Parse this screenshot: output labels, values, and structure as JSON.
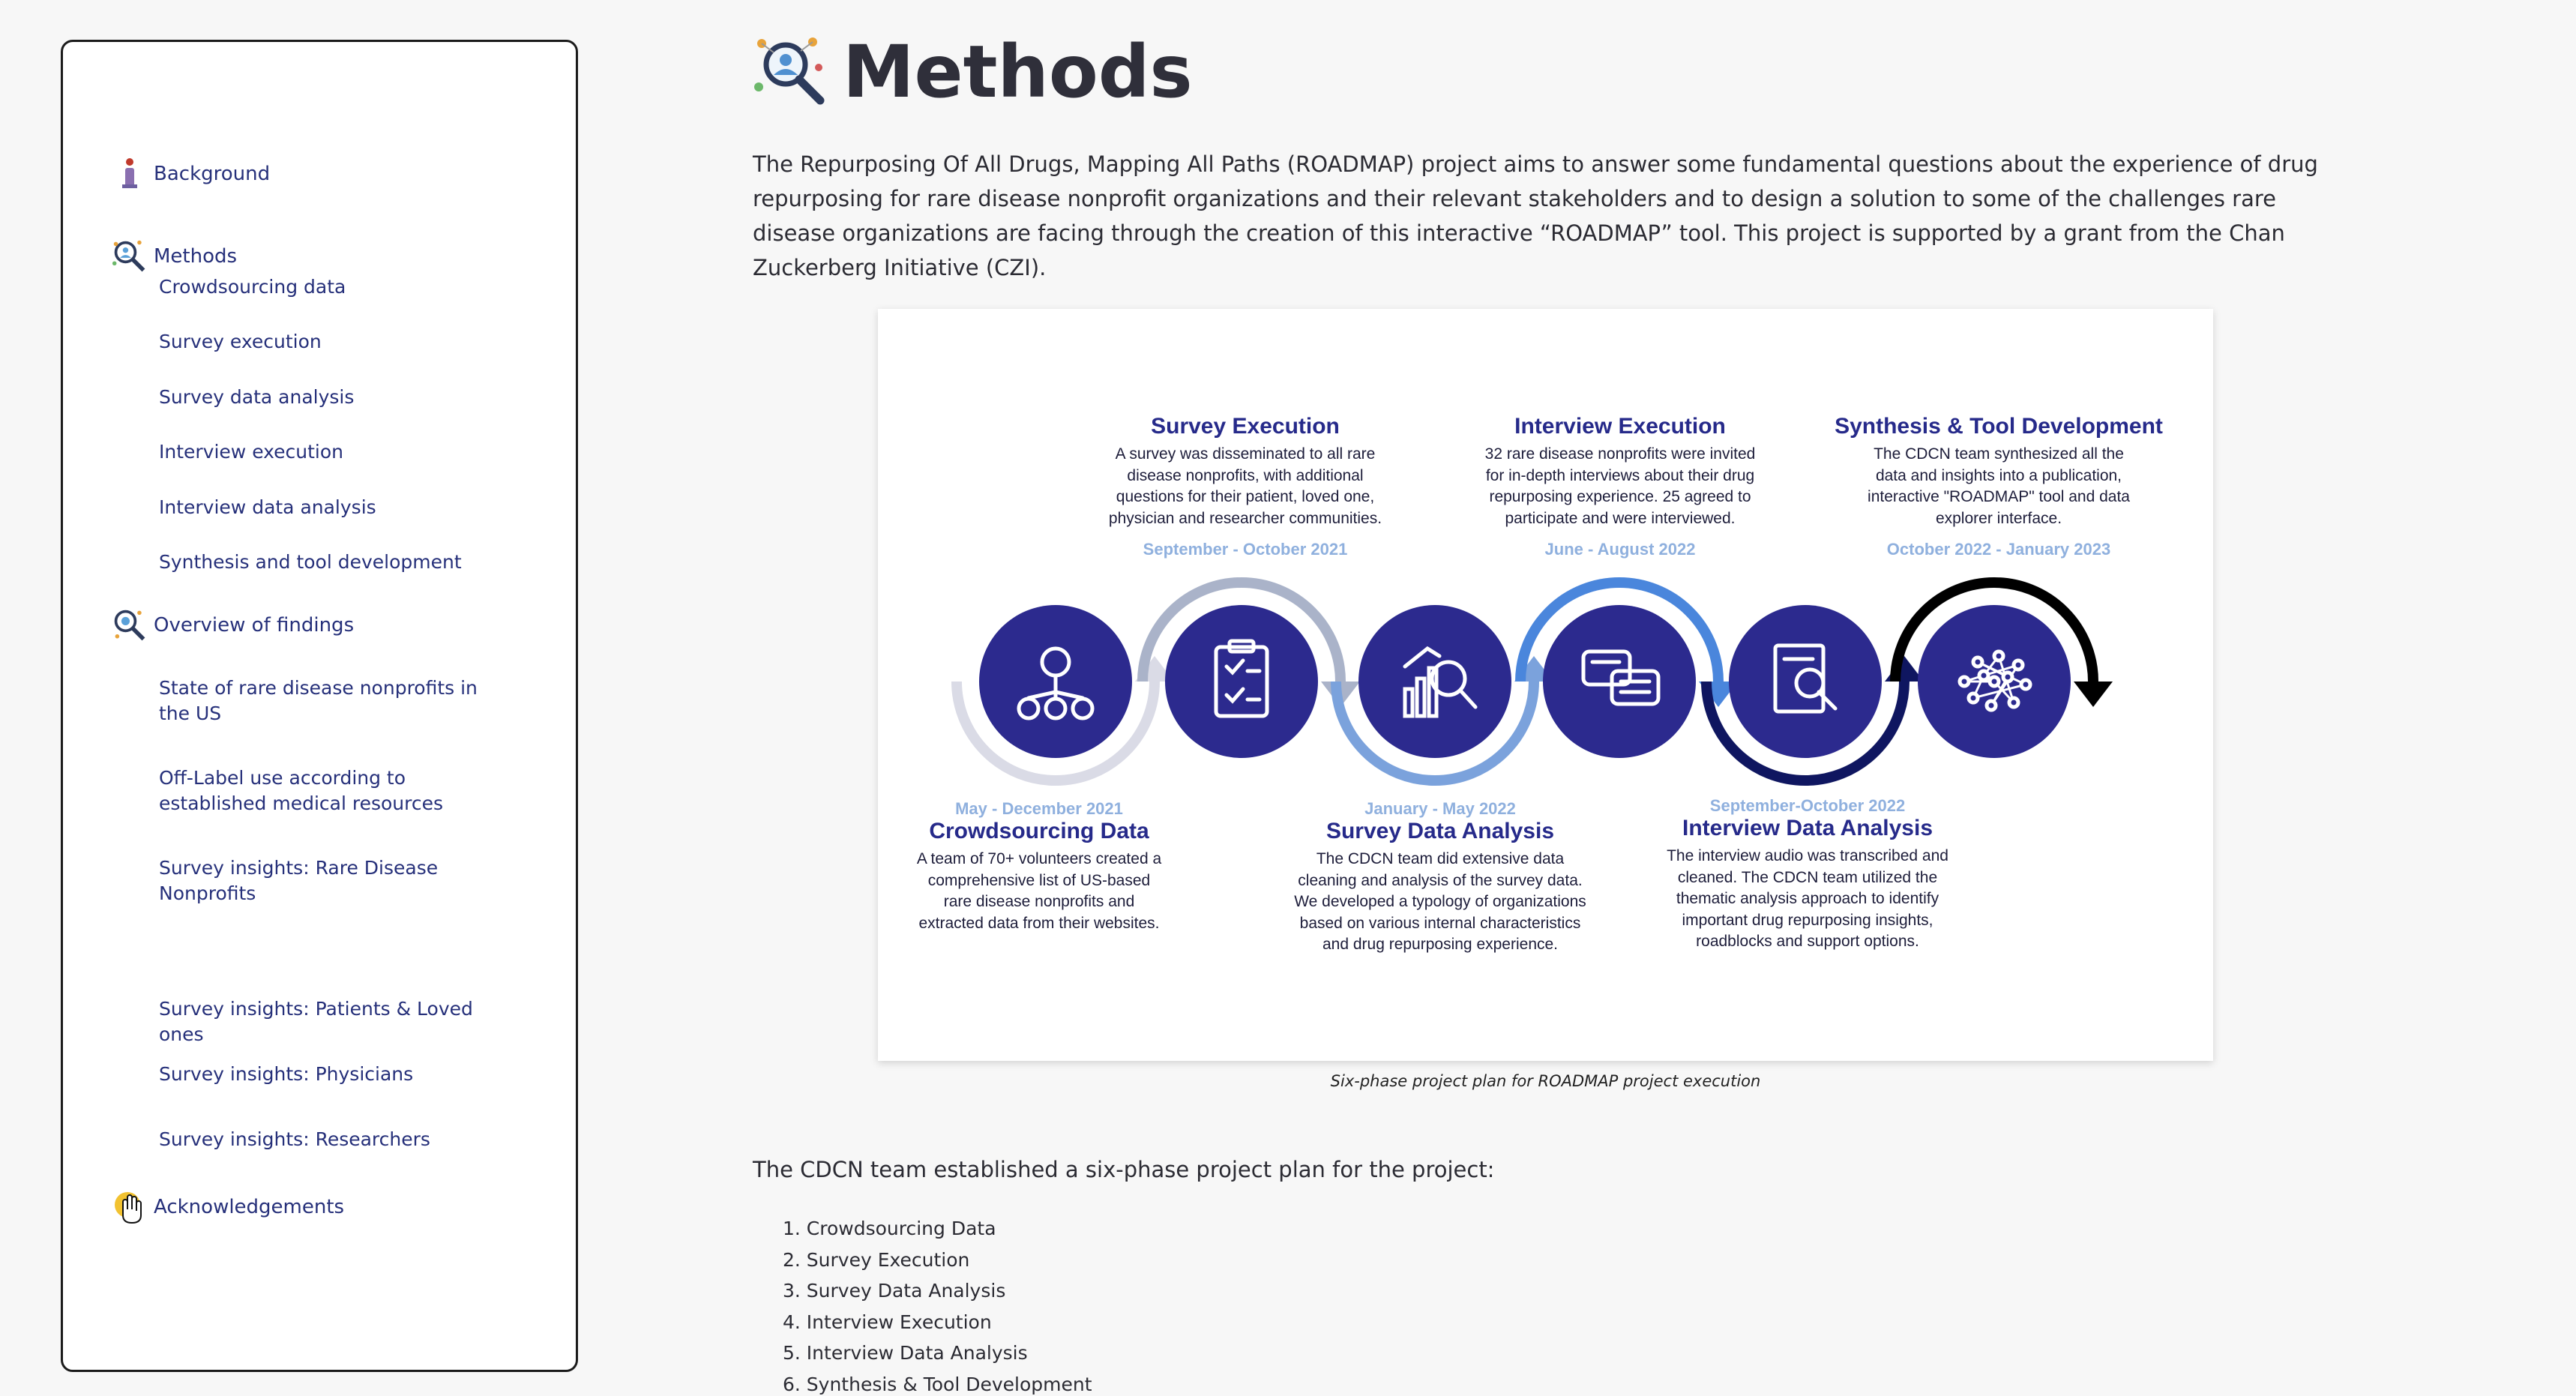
{
  "sidebar": {
    "sections": [
      {
        "label": "Background",
        "icon": "info-icon"
      },
      {
        "label": "Methods",
        "icon": "methods-magnifier-icon"
      },
      {
        "label": "Overview of findings",
        "icon": "findings-magnifier-icon"
      },
      {
        "label": "Acknowledgements",
        "icon": "hand-icon"
      }
    ],
    "methods_items": [
      "Crowdsourcing data",
      "Survey execution",
      "Survey data analysis",
      "Interview execution",
      "Interview data analysis",
      "Synthesis and tool development"
    ],
    "findings_items": [
      "State of rare disease nonprofits in the US",
      "Off-Label use according to established medical resources",
      "Survey insights: Rare Disease Nonprofits",
      "Survey insights: Patients & Loved ones",
      "Survey insights: Physicians",
      "Survey insights: Researchers"
    ]
  },
  "main": {
    "title": "Methods",
    "intro": "The Repurposing Of All Drugs, Mapping All Paths (ROADMAP) project aims to answer some fundamental questions about the experience of drug repurposing for rare disease nonprofit organizations and their relevant stakeholders and to design a solution to some of the challenges rare disease organizations are facing through the creation of this interactive “ROADMAP” tool. This project is supported by a grant from the Chan Zuckerberg Initiative (CZI).",
    "caption": "Six-phase project plan for ROADMAP project execution",
    "lead": "The CDCN team established a six-phase project plan for the project:",
    "steps": [
      "1. Crowdsourcing Data",
      "2. Survey Execution",
      "3. Survey Data Analysis",
      "4. Interview Execution",
      "5. Interview Data Analysis",
      "6. Synthesis & Tool Development"
    ]
  },
  "figure": {
    "phases": [
      {
        "title": "Crowdsourcing Data",
        "date": "May - December 2021",
        "desc": [
          "A team of 70+ volunteers created a",
          "comprehensive list of US-based",
          "rare disease nonprofits and",
          "extracted data from their websites."
        ],
        "icon": "lightbulb-people-icon"
      },
      {
        "title": "Survey Execution",
        "date": "September - October 2021",
        "desc": [
          "A survey was disseminated to all rare",
          "disease nonprofits, with additional",
          "questions for their patient, loved one,",
          "physician and researcher communities."
        ],
        "icon": "clipboard-checklist-icon"
      },
      {
        "title": "Survey Data Analysis",
        "date": "January - May 2022",
        "desc": [
          "The CDCN team did extensive data",
          "cleaning and analysis of the survey data.",
          "We developed a typology of organizations",
          "based on various internal characteristics",
          "and drug repurposing experience."
        ],
        "icon": "chart-magnifier-icon"
      },
      {
        "title": "Interview Execution",
        "date": "June - August 2022",
        "desc": [
          "32 rare disease nonprofits were invited",
          "for in-depth interviews about their drug",
          "repurposing experience. 25 agreed to",
          "participate and were interviewed."
        ],
        "icon": "speech-bubbles-icon"
      },
      {
        "title": "Interview Data Analysis",
        "date": "September-October 2022",
        "desc": [
          "The interview audio was transcribed and",
          "cleaned. The CDCN team utilized the",
          "thematic analysis approach to identify",
          "important drug repurposing insights,",
          "roadblocks and support options."
        ],
        "icon": "document-search-icon"
      },
      {
        "title": "Synthesis & Tool Development",
        "date": "October 2022 - January 2023",
        "desc": [
          "The CDCN team synthesized all the",
          "data and insights into a publication,",
          "interactive \"ROADMAP\" tool and data",
          "explorer interface."
        ],
        "icon": "network-brain-icon"
      }
    ],
    "colors": {
      "circle": "#2c2a8e",
      "arc1": "#dadbe6",
      "arc2": "#aab3c9",
      "arc3": "#7ba2dc",
      "arc4": "#4a86dc",
      "arc5": "#0f1660",
      "arc6": "#000000",
      "date": "#8fb0de"
    }
  }
}
